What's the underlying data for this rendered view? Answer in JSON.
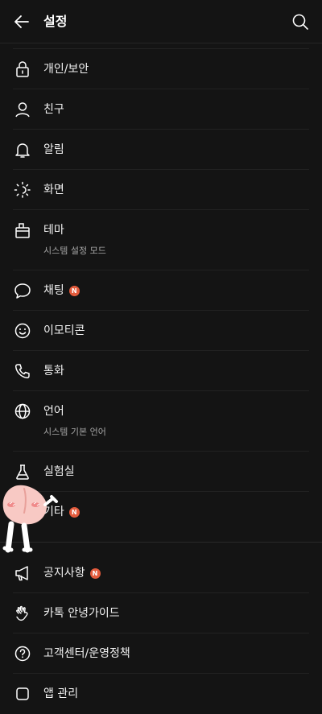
{
  "header": {
    "title": "설정"
  },
  "items_top": [
    {
      "key": "privacy",
      "label": "개인/보안",
      "icon": "lock-icon"
    },
    {
      "key": "friends",
      "label": "친구",
      "icon": "person-icon"
    },
    {
      "key": "notifications",
      "label": "알림",
      "icon": "bell-icon"
    },
    {
      "key": "display",
      "label": "화면",
      "icon": "brightness-icon"
    },
    {
      "key": "theme",
      "label": "테마",
      "sub": "시스템 설정 모드",
      "icon": "theme-icon"
    },
    {
      "key": "chat",
      "label": "채팅",
      "badge": "N",
      "icon": "chat-bubble-icon"
    },
    {
      "key": "emoticon",
      "label": "이모티콘",
      "icon": "smiley-icon"
    },
    {
      "key": "call",
      "label": "통화",
      "icon": "phone-icon"
    },
    {
      "key": "language",
      "label": "언어",
      "sub": "시스템 기본 언어",
      "icon": "globe-icon"
    },
    {
      "key": "lab",
      "label": "실험실",
      "icon": "flask-icon"
    },
    {
      "key": "etc",
      "label": "기타",
      "badge": "N",
      "icon": "more-icon"
    }
  ],
  "items_bottom": [
    {
      "key": "notice",
      "label": "공지사항",
      "badge": "N",
      "icon": "megaphone-icon"
    },
    {
      "key": "guide",
      "label": "카톡 안녕가이드",
      "icon": "wave-hand-icon"
    },
    {
      "key": "support",
      "label": "고객센터/운영정책",
      "icon": "question-icon"
    },
    {
      "key": "app",
      "label": "앱 관리",
      "icon": "app-icon"
    }
  ],
  "colors": {
    "background": "#141414",
    "badge": "#e35b3c",
    "text": "#f2f2f2",
    "subtext": "#a6a6a6"
  }
}
